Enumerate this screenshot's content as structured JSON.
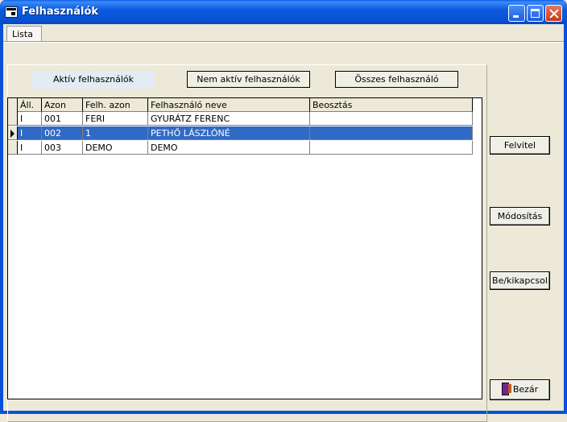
{
  "window": {
    "title": "Felhasználók"
  },
  "tabs": [
    {
      "label": "Lista"
    }
  ],
  "filters": {
    "active": "Aktív felhasználók",
    "inactive": "Nem aktív felhasználók",
    "all": "Összes felhasználó"
  },
  "table": {
    "columns": [
      "Áll.",
      "Azon",
      "Felh. azon",
      "Felhasználó neve",
      "Beosztás"
    ],
    "rows": [
      [
        "I",
        "001",
        "FERI",
        "GYURÁTZ FERENC",
        ""
      ],
      [
        "I",
        "002",
        "1",
        "PETHŐ LÁSZLÓNÉ",
        ""
      ],
      [
        "I",
        "003",
        "DEMO",
        "DEMO",
        ""
      ]
    ],
    "selected_row": 1
  },
  "actions": {
    "add": "Felvitel",
    "edit": "Módosítás",
    "toggle": "Be/kikapcsol",
    "close": "Bezár"
  },
  "colors": {
    "selection": "#316ac5",
    "titlebar": "#0a5fe8",
    "background": "#ece9d8"
  }
}
